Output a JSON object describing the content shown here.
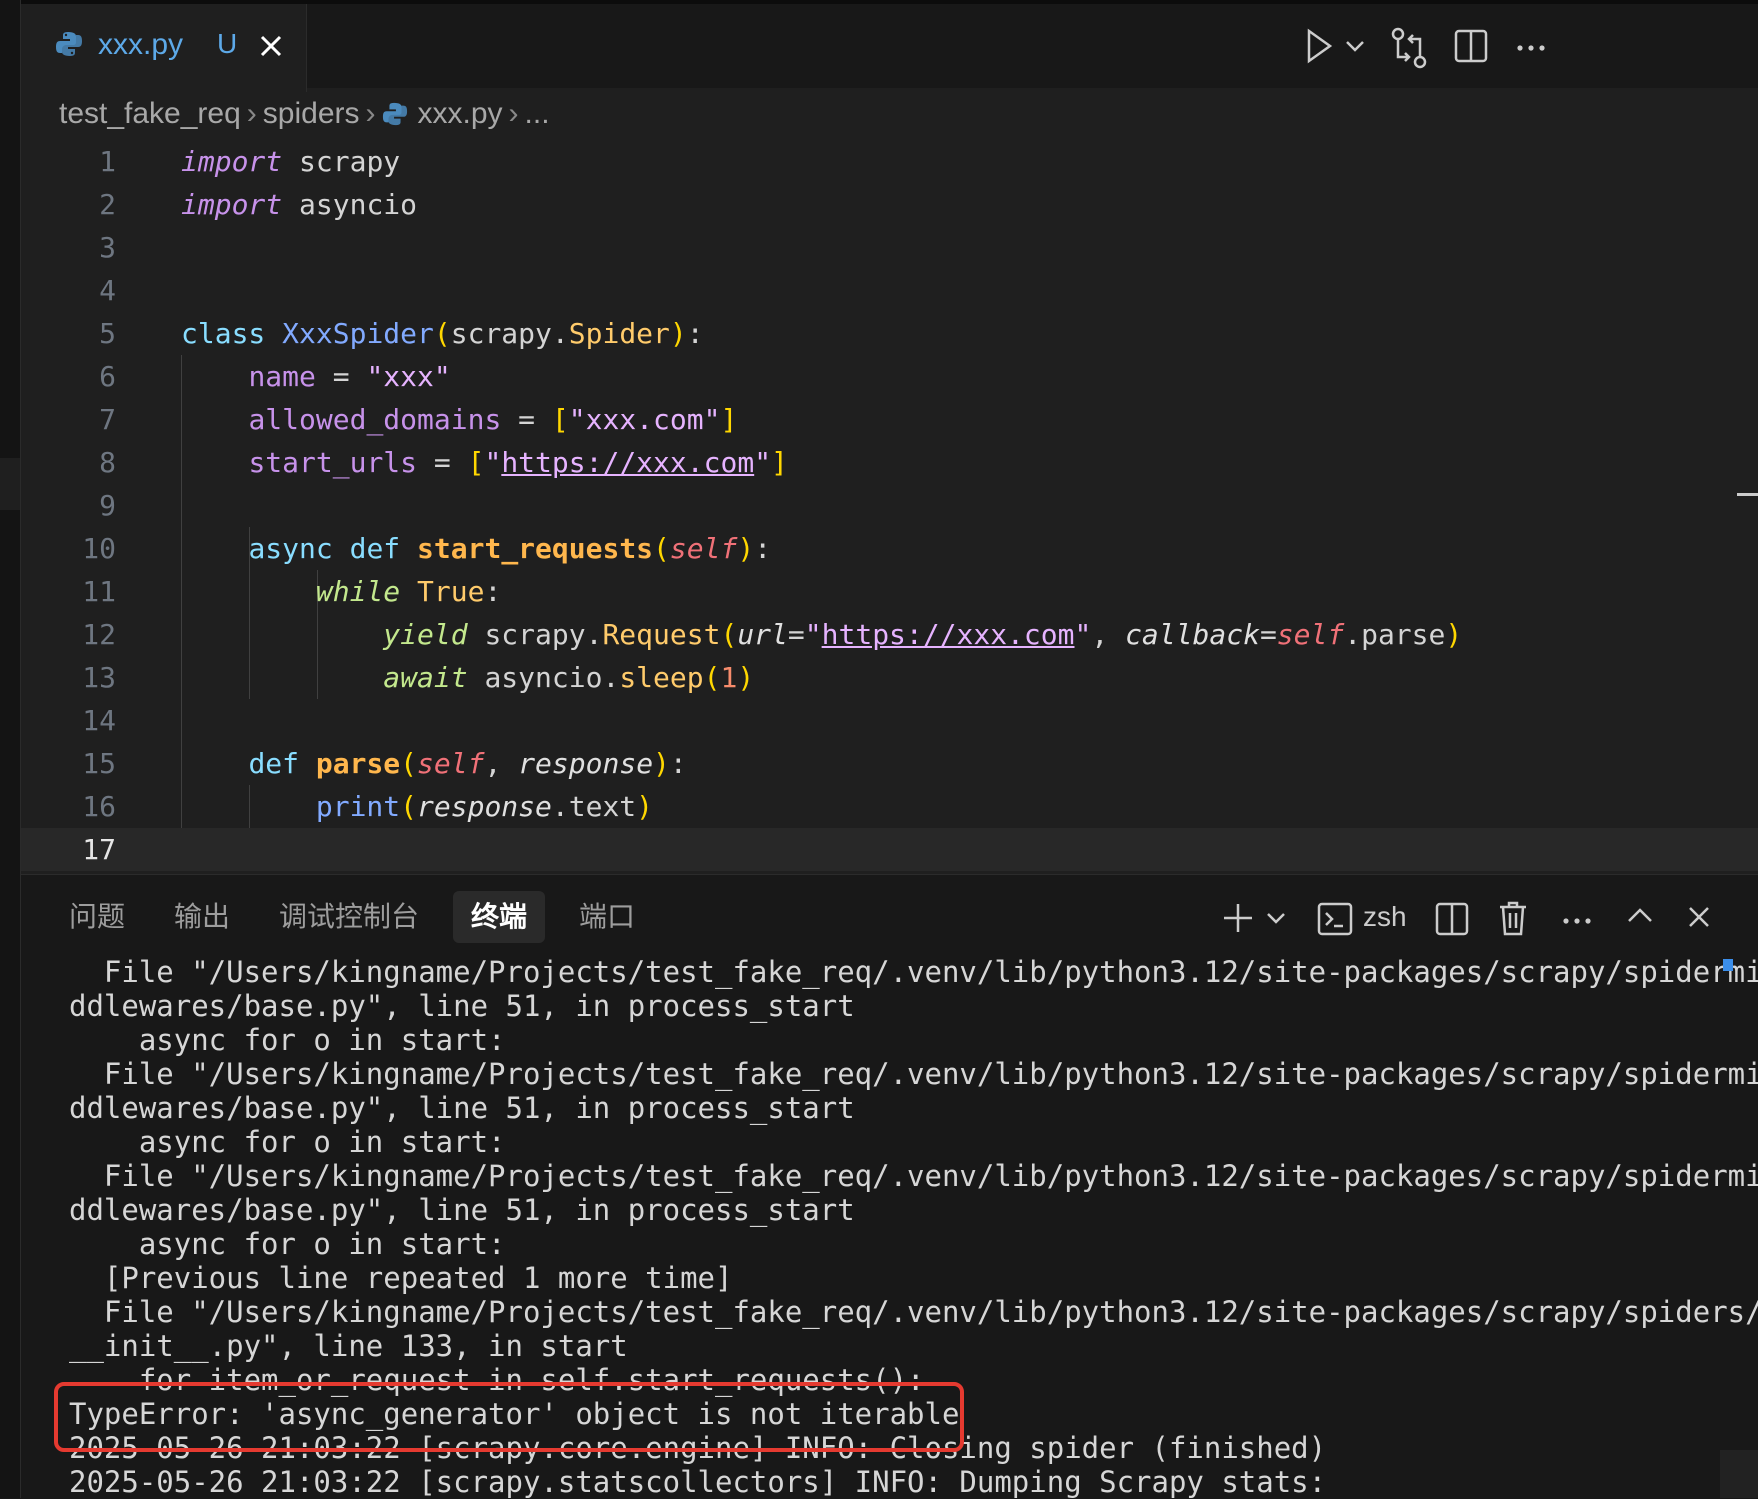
{
  "tab": {
    "filename": "xxx.py",
    "badge": "U"
  },
  "breadcrumb": {
    "items": [
      "test_fake_req",
      "spiders",
      "xxx.py",
      "..."
    ]
  },
  "editor": {
    "current_line": "17",
    "line_numbers": [
      "1",
      "2",
      "3",
      "4",
      "5",
      "6",
      "7",
      "8",
      "9",
      "10",
      "11",
      "12",
      "13",
      "14",
      "15",
      "16",
      "17"
    ]
  },
  "panel": {
    "tabs": [
      "问题",
      "输出",
      "调试控制台",
      "终端",
      "端口"
    ],
    "active_tab": "终端",
    "shell": "zsh"
  },
  "terminal": {
    "lines": [
      "  File \"/Users/kingname/Projects/test_fake_req/.venv/lib/python3.12/site-packages/scrapy/spidermi",
      "ddlewares/base.py\", line 51, in process_start",
      "    async for o in start:",
      "  File \"/Users/kingname/Projects/test_fake_req/.venv/lib/python3.12/site-packages/scrapy/spidermi",
      "ddlewares/base.py\", line 51, in process_start",
      "    async for o in start:",
      "  File \"/Users/kingname/Projects/test_fake_req/.venv/lib/python3.12/site-packages/scrapy/spidermi",
      "ddlewares/base.py\", line 51, in process_start",
      "    async for o in start:",
      "  [Previous line repeated 1 more time]",
      "  File \"/Users/kingname/Projects/test_fake_req/.venv/lib/python3.12/site-packages/scrapy/spiders/",
      "__init__.py\", line 133, in start",
      "    for item_or_request in self.start_requests():",
      "TypeError: 'async_generator' object is not iterable",
      "2025-05-26 21:03:22 [scrapy.core.engine] INFO: Closing spider (finished)",
      "2025-05-26 21:03:22 [scrapy.statscollectors] INFO: Dumping Scrapy stats:"
    ]
  },
  "colors": {
    "accent_tab": "#5da9e8",
    "error_box": "#e53a30"
  }
}
